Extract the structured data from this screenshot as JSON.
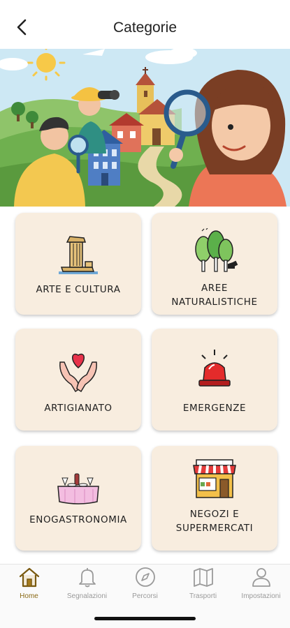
{
  "header": {
    "title": "Categorie"
  },
  "categories": [
    {
      "label": "ARTE E CULTURA",
      "icon": "column-ruin-icon"
    },
    {
      "label": "AREE NATURALISTICHE",
      "icon": "trees-icon"
    },
    {
      "label": "ARTIGIANATO",
      "icon": "hands-heart-icon"
    },
    {
      "label": "EMERGENZE",
      "icon": "siren-icon"
    },
    {
      "label": "ENOGASTRONOMIA",
      "icon": "dinner-table-icon"
    },
    {
      "label": "NEGOZI E SUPERMERCATI",
      "icon": "shop-icon"
    }
  ],
  "tabs": [
    {
      "label": "Home",
      "icon": "home-icon",
      "active": true
    },
    {
      "label": "Segnalazioni",
      "icon": "bell-icon",
      "active": false
    },
    {
      "label": "Percorsi",
      "icon": "compass-icon",
      "active": false
    },
    {
      "label": "Trasporti",
      "icon": "map-icon",
      "active": false
    },
    {
      "label": "Impostazioni",
      "icon": "user-icon",
      "active": false
    }
  ],
  "colors": {
    "card_bg": "#f8eddf",
    "active_tab": "#8b6a16",
    "inactive_tab": "#9a9a9a"
  }
}
